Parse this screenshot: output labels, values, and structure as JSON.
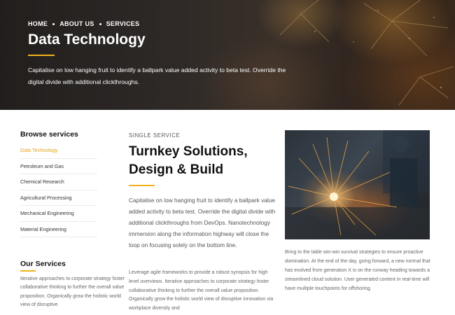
{
  "colors": {
    "accent": "#f2b21b",
    "active_link": "#e0a317"
  },
  "breadcrumb": [
    "HOME",
    "ABOUT US",
    "SERVICES"
  ],
  "hero": {
    "title": "Data Technology",
    "description": "Capitalise on low hanging fruit to identify a ballpark value added activity to beta test. Override the digital divide with additional clickthroughs."
  },
  "sidebar": {
    "browse_title": "Browse services",
    "items": [
      {
        "label": "Data Technology",
        "active": true
      },
      {
        "label": "Petroleum and Gas",
        "active": false
      },
      {
        "label": "Chemical Research",
        "active": false
      },
      {
        "label": "Agricultural Processing",
        "active": false
      },
      {
        "label": "Mechanical Engineering",
        "active": false
      },
      {
        "label": "Material Engineering",
        "active": false
      }
    ],
    "services_title": "Our Services",
    "services_text": "Iterative approaches to corporate strategy foster collaborative thinking to further the overall value proposition. Organically grow the holistic world view of disruptive"
  },
  "main": {
    "eyebrow": "SINGLE SERVICE",
    "title": "Turnkey Solutions, Design & Build",
    "lead": "Capitalise on low hanging fruit to identify a ballpark value added activity to beta test. Override the digital divide with additional clickthroughs from DevOps. Nanotechnology immersion along the information highway will close the loop on focusing solely on the bottom line.",
    "body": "Leverage agile frameworks to provide a robust synopsis for high level overviews. Iterative approaches to corporate strategy foster collaborative thinking to further the overall value proposition. Organically grow the holistic world view of disruptive innovation via workplace diversity and"
  },
  "right": {
    "image_icon": "welding-photo",
    "text": "Bring to the table win-win survival strategies to ensure proactive domination. At the end of the day, going forward, a new normal that has evolved from generation X is on the runway heading towards a streamlined cloud solution. User generated content in real-time will have multiple touchpoints for offshoring."
  }
}
